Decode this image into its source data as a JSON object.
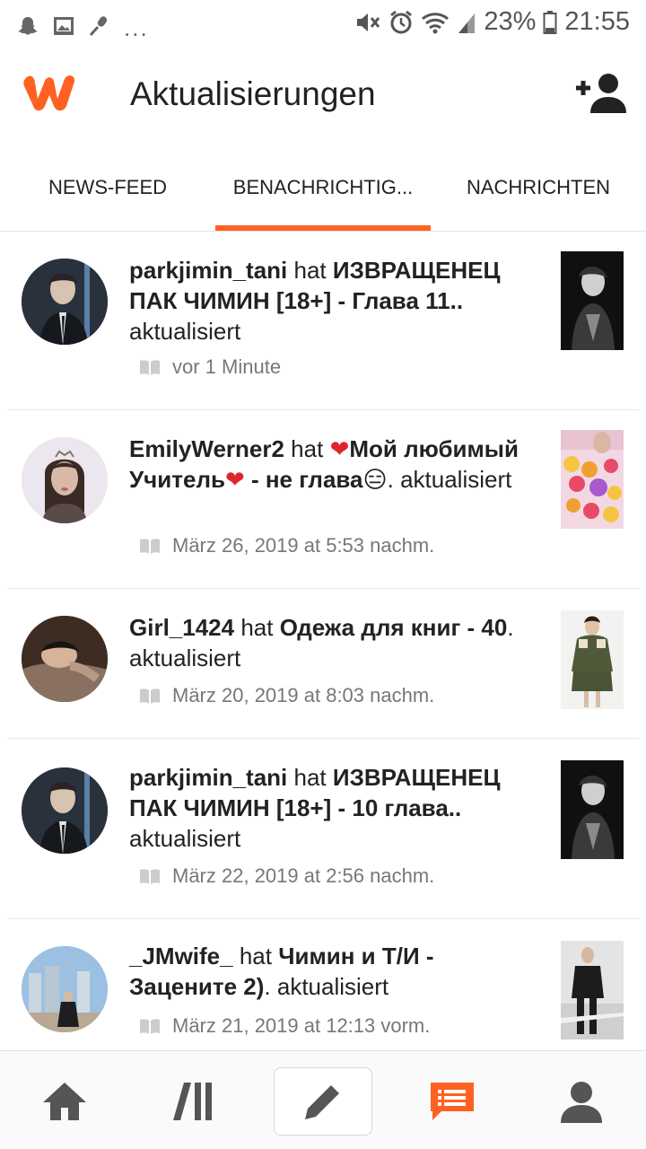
{
  "status_bar": {
    "icons_left": [
      "snapchat-icon",
      "image-icon",
      "mic-icon"
    ],
    "more": "...",
    "icons_right": [
      "mute-icon",
      "alarm-icon",
      "wifi-icon",
      "signal-icon",
      "battery-icon"
    ],
    "battery": "23%",
    "time": "21:55"
  },
  "header": {
    "title": "Aktualisierungen",
    "logo": "wattpad-logo",
    "action_icon": "add-user-icon",
    "accent_color": "#ff6122"
  },
  "tabs": [
    {
      "label": "NEWS-FEED",
      "active": false
    },
    {
      "label": "BENACHRICHTIG...",
      "active": true
    },
    {
      "label": "NACHRICHTEN",
      "active": false
    }
  ],
  "feed": [
    {
      "user": "parkjimin_tani",
      "verb": "hat",
      "story": "ИЗВРАЩЕНЕЦ ПАК ЧИМИН [18+] - Глава 11..",
      "suffix": "aktualisiert",
      "time": "vor 1 Minute"
    },
    {
      "user": "EmilyWerner2",
      "verb": "hat",
      "story_heart": "❤",
      "story_a": "Мой любимый Учитель",
      "story_heart2": "❤",
      "story_b": " - не глава",
      "story_emoji": "😑",
      "suffix": ". aktualisiert",
      "time": "März 26, 2019 at 5:53 nachm."
    },
    {
      "user": "Girl_1424",
      "verb": "hat",
      "story": "Одежа для книг - 40",
      "suffix": ". aktualisiert",
      "time": "März 20, 2019 at 8:03 nachm."
    },
    {
      "user": "parkjimin_tani",
      "verb": "hat",
      "story": "ИЗВРАЩЕНЕЦ ПАК ЧИМИН [18+] - 10 глава..",
      "suffix": "aktualisiert",
      "time": "März 22, 2019 at 2:56 nachm."
    },
    {
      "user": "_JMwife_",
      "verb": "hat",
      "story": "Чимин и Т/И - Зацените 2)",
      "suffix": ". aktualisiert",
      "time": "März 21, 2019 at 12:13 vorm."
    }
  ],
  "bottom_nav": [
    "home-icon",
    "library-icon",
    "write-icon",
    "notifications-icon",
    "profile-icon"
  ]
}
